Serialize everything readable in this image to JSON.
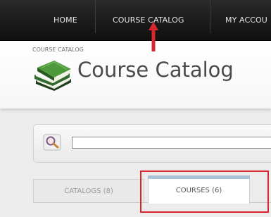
{
  "nav": {
    "items": [
      {
        "label": "HOME"
      },
      {
        "label": "COURSE CATALOG"
      },
      {
        "label": "MY ACCOU"
      }
    ]
  },
  "header": {
    "breadcrumb": "COURSE CATALOG",
    "title": "Course Catalog"
  },
  "search": {
    "value": "",
    "placeholder": ""
  },
  "tabs": [
    {
      "label": "CATALOGS (8)"
    },
    {
      "label": "COURSES (6)"
    }
  ],
  "colors": {
    "nav_bg": "#1a1a1a",
    "annotation_red": "#d9262d",
    "active_tab_accent": "#a9c3d8"
  }
}
